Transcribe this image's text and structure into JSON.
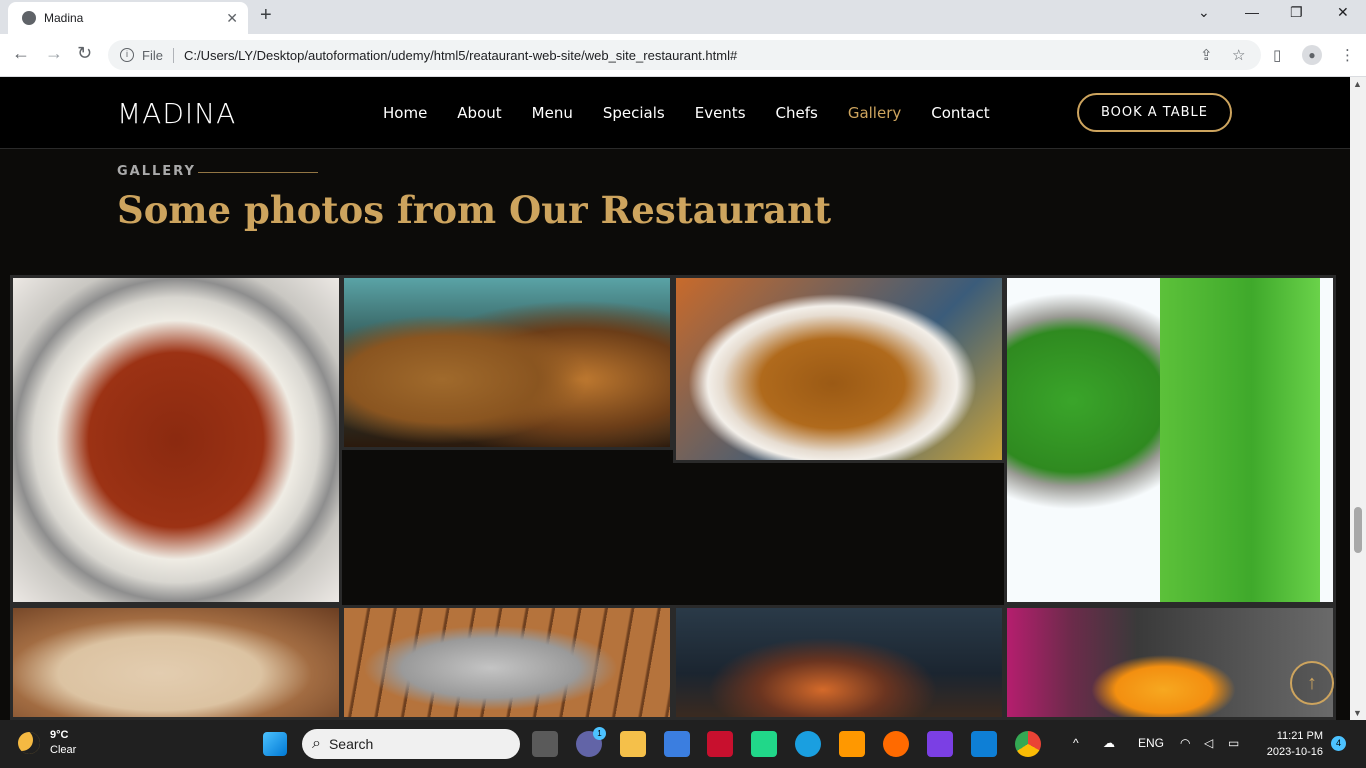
{
  "browser": {
    "tab_title": "Madina",
    "url_scheme": "File",
    "url": "C:/Users/LY/Desktop/autoformation/udemy/html5/reataurant-web-site/web_site_restaurant.html#"
  },
  "site": {
    "logo": "MADINA",
    "nav": [
      "Home",
      "About",
      "Menu",
      "Specials",
      "Events",
      "Chefs",
      "Gallery",
      "Contact"
    ],
    "active_nav": "Gallery",
    "book_button": "BOOK A TABLE",
    "accent_color": "#cda45e"
  },
  "gallery": {
    "label": "GALLERY",
    "title": "Some photos from Our Restaurant",
    "images": [
      {
        "alt": "Rice with meat stew"
      },
      {
        "alt": "Thieboudienne fish and rice"
      },
      {
        "alt": "Okra seafood soup with crab"
      },
      {
        "alt": "Baobab green juice"
      },
      {
        "alt": "Creamy drink with nuts"
      },
      {
        "alt": "Grilled fish platter"
      },
      {
        "alt": "Restaurant interior"
      },
      {
        "alt": "Orange juice being served"
      }
    ]
  },
  "taskbar": {
    "temperature": "9°C",
    "condition": "Clear",
    "search_placeholder": "Search",
    "language": "ENG",
    "time": "11:21 PM",
    "date": "2023-10-16",
    "notifications": "4",
    "teams_badge": "1"
  }
}
